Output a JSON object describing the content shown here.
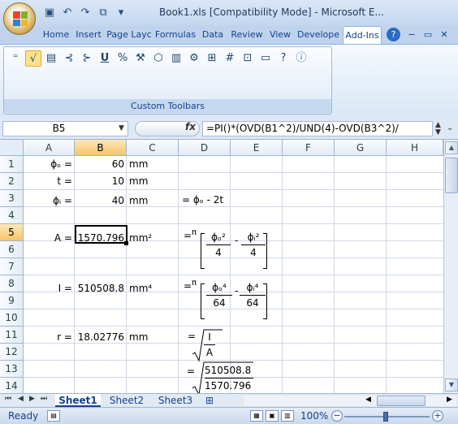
{
  "window": {
    "title": "Book1.xls  [Compatibility Mode] - Microsoft E..."
  },
  "ribbon_tabs": [
    "Home",
    "Insert",
    "Page Layc",
    "Formulas",
    "Data",
    "Review",
    "View",
    "Develope",
    "Add-Ins"
  ],
  "active_tab": "Add-Ins",
  "toolbar_icons": [
    "equals-icon",
    "sqrt-icon",
    "stack-icon",
    "tree-icon",
    "tree2-icon",
    "underline-icon",
    "percent-icon",
    "tools-icon",
    "cube-icon",
    "chart-icon",
    "gear-icon",
    "ruler-icon",
    "grid-icon",
    "box-icon",
    "card-icon",
    "help-pointer-icon",
    "info-icon"
  ],
  "group_label": "Custom Toolbars",
  "namebox": "B5",
  "formula": "=PI()*(OVD(B1^2)/UND(4)-OVD(B3^2)/",
  "columns": [
    "A",
    "B",
    "C",
    "D",
    "E",
    "F",
    "G",
    "H"
  ],
  "rows": [
    "1",
    "2",
    "3",
    "4",
    "5",
    "6",
    "7",
    "8",
    "9",
    "10",
    "11",
    "12",
    "13",
    "14"
  ],
  "cells": {
    "a1": "ϕₒ =",
    "b1": "60",
    "c1": "mm",
    "a2": "t =",
    "b2": "10",
    "c2": "mm",
    "a3": "ϕᵢ =",
    "b3": "40",
    "c3": "mm",
    "d3": "= ϕₒ - 2t",
    "a5": "A =",
    "b5": "1570.796",
    "c5": "mm²",
    "a8": "I =",
    "b8": "510508.8",
    "c8": "mm⁴",
    "a11": "r =",
    "b11": "18.02776",
    "c11": "mm"
  },
  "formulas": {
    "eq": "=",
    "pi": "π",
    "minus": "-",
    "area_num1": "ϕₒ²",
    "area_num2": "ϕᵢ²",
    "area_den": "4",
    "inertia_num1": "ϕₒ⁴",
    "inertia_num2": "ϕᵢ⁴",
    "inertia_den": "64",
    "r_num": "I",
    "r_den": "A",
    "r_num_val": "510508.8",
    "r_den_val": "1570.796"
  },
  "sheets": [
    "Sheet1",
    "Sheet2",
    "Sheet3"
  ],
  "active_sheet": "Sheet1",
  "status": {
    "ready": "Ready",
    "zoom": "100%"
  }
}
